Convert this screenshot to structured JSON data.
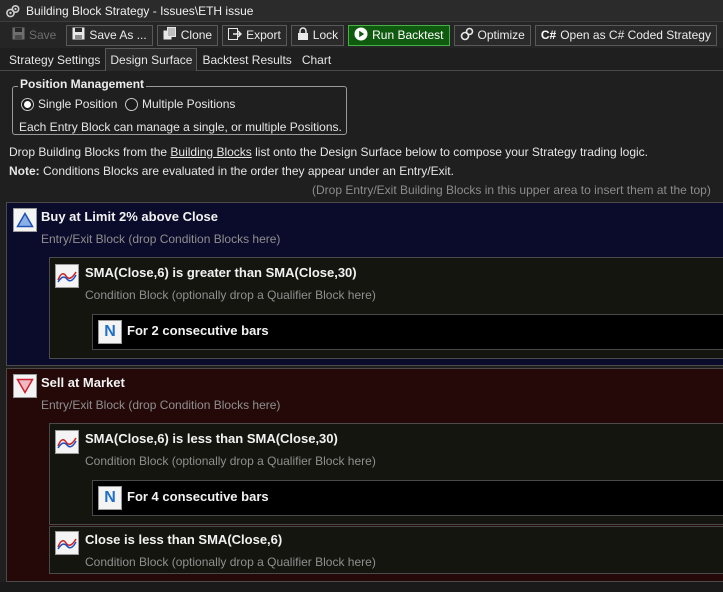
{
  "window": {
    "title": "Building Block Strategy - Issues\\ETH issue",
    "app_icon": "gears-icon"
  },
  "toolbar": {
    "save_label": "Save",
    "save_as_label": "Save As ...",
    "clone_label": "Clone",
    "export_label": "Export",
    "lock_label": "Lock",
    "run_backtest_label": "Run Backtest",
    "optimize_label": "Optimize",
    "open_csharp_label": "Open as C# Coded Strategy",
    "run_color": "#0f5a0f",
    "run_border_color": "#46b146"
  },
  "tabs": [
    {
      "label": "Strategy Settings",
      "active": false
    },
    {
      "label": "Design Surface",
      "active": true
    },
    {
      "label": "Backtest Results",
      "active": false
    },
    {
      "label": "Chart",
      "active": false
    }
  ],
  "position_management": {
    "title": "Position Management",
    "options": [
      {
        "label": "Single Position",
        "selected": true
      },
      {
        "label": "Multiple Positions",
        "selected": false
      }
    ],
    "description": "Each Entry Block can manage a single, or multiple Positions."
  },
  "info": {
    "line1_prefix": "Drop Building Blocks from the ",
    "line1_link": "Building Blocks",
    "line1_suffix": " list onto the Design Surface below to compose your Strategy trading logic.",
    "note_label": "Note:",
    "note_text": " Conditions Blocks are evaluated in the order they appear under an Entry/Exit.",
    "drop_hint": "(Drop Entry/Exit Building Blocks in this upper area to insert them at the top)"
  },
  "blocks": {
    "buy": {
      "title": "Buy at Limit 2% above Close",
      "subtitle": "Entry/Exit Block (drop Condition Blocks here)",
      "icon": "buy-triangle-up-icon",
      "background": "#0b0b2c",
      "condition": {
        "title": "SMA(Close,6) is greater than SMA(Close,30)",
        "subtitle": "Condition Block (optionally drop a Qualifier Block here)",
        "icon": "chart-line-icon",
        "qualifier": {
          "title": "For 2 consecutive bars",
          "icon": "n-letter-icon"
        }
      }
    },
    "sell": {
      "title": "Sell at Market",
      "subtitle": "Entry/Exit Block (drop Condition Blocks here)",
      "icon": "sell-triangle-down-icon",
      "background": "#250909",
      "condition1": {
        "title": "SMA(Close,6) is less than SMA(Close,30)",
        "subtitle": "Condition Block (optionally drop a Qualifier Block here)",
        "icon": "chart-line-icon",
        "qualifier": {
          "title": "For 4 consecutive bars",
          "icon": "n-letter-icon"
        }
      },
      "condition2": {
        "title": "Close is less than SMA(Close,6)",
        "subtitle": "Condition Block (optionally drop a Qualifier Block here)",
        "icon": "chart-line-icon"
      }
    }
  }
}
